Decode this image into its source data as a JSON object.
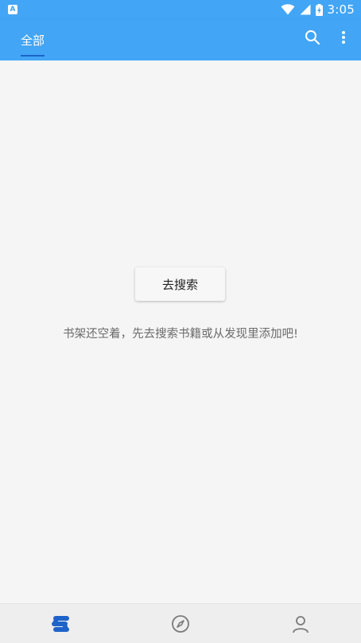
{
  "status_bar": {
    "notification_icon_letter": "A",
    "time": "3:05"
  },
  "app_bar": {
    "tab_label": "全部",
    "accent_color": "#42a5f5",
    "indicator_color": "#1e63c9"
  },
  "empty_state": {
    "button_label": "去搜索",
    "message": "书架还空着，先去搜索书籍或从发现里添加吧!"
  },
  "bottom_nav": {
    "items": [
      {
        "icon": "bookshelf-icon",
        "selected": true
      },
      {
        "icon": "compass-icon",
        "selected": false
      },
      {
        "icon": "person-icon",
        "selected": false
      }
    ]
  }
}
